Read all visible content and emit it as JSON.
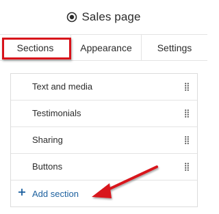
{
  "header": {
    "title": "Sales page",
    "icon": "eye-icon"
  },
  "tabs": [
    {
      "label": "Sections",
      "active": true
    },
    {
      "label": "Appearance",
      "active": false
    },
    {
      "label": "Settings",
      "active": false
    }
  ],
  "sections": {
    "items": [
      {
        "label": "Text and media"
      },
      {
        "label": "Testimonials"
      },
      {
        "label": "Sharing"
      },
      {
        "label": "Buttons"
      }
    ],
    "add_label": "Add section"
  },
  "colors": {
    "highlight": "#d8121a",
    "link": "#1b5f9e",
    "text": "#2b2b2b",
    "border": "#e3e3e3"
  }
}
